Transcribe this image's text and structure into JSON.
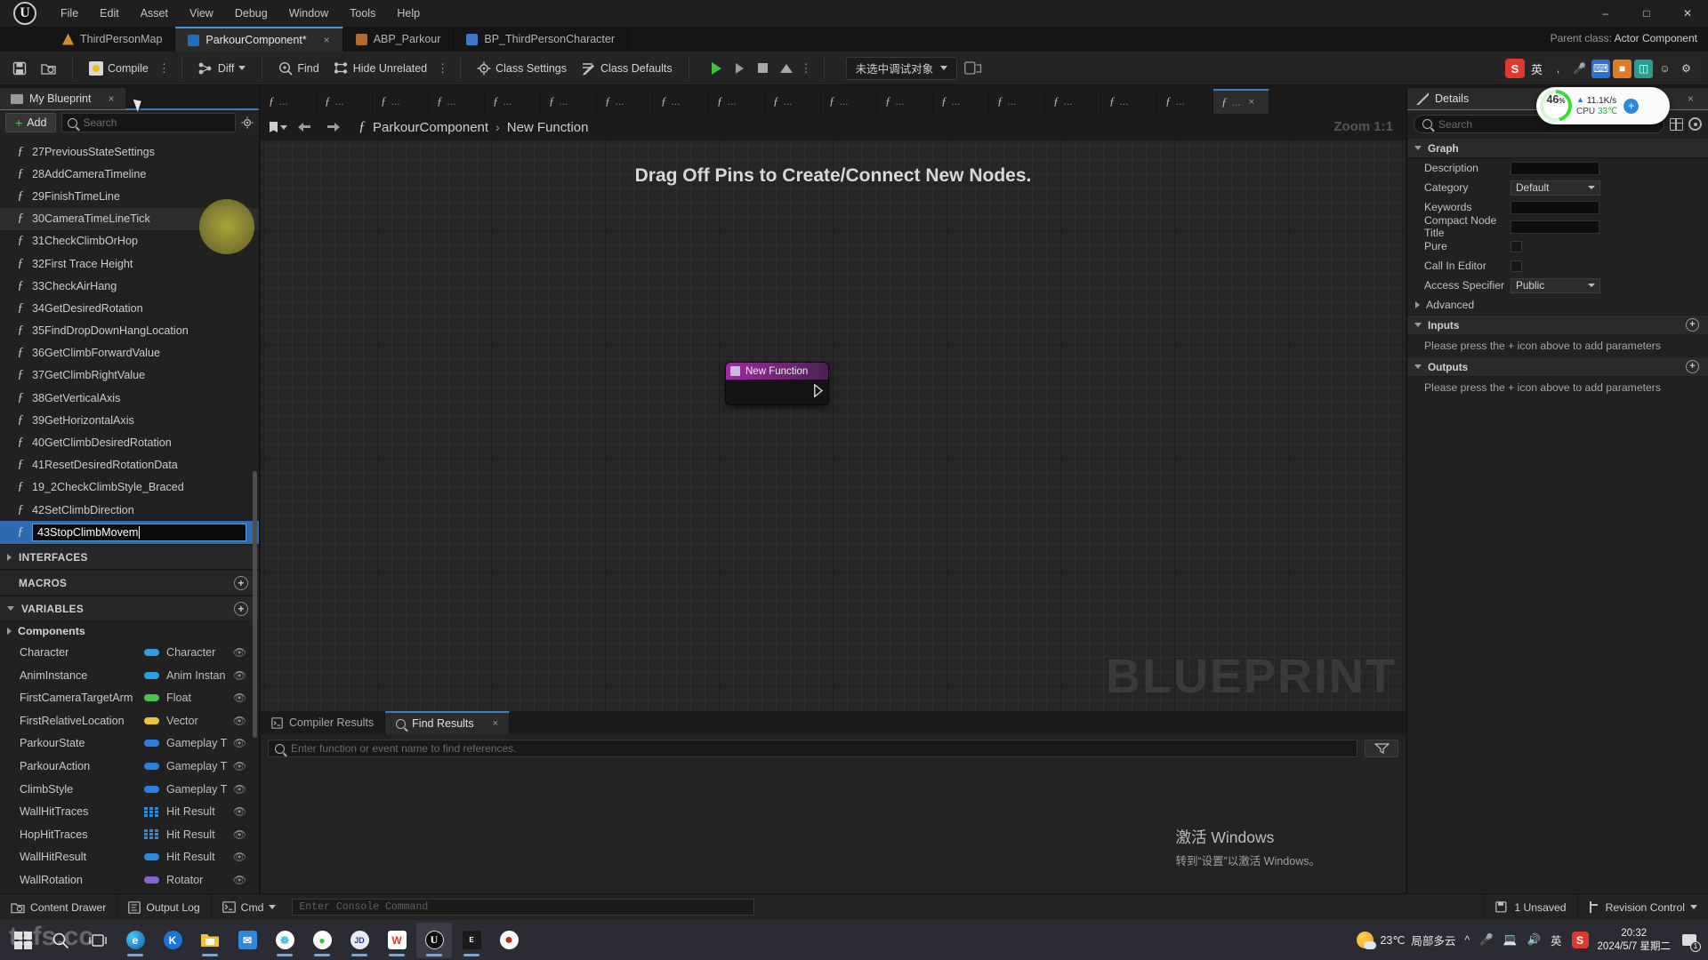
{
  "titlebar": {
    "logo": "ue-logo",
    "menus": [
      "File",
      "Edit",
      "Asset",
      "View",
      "Debug",
      "Window",
      "Tools",
      "Help"
    ],
    "window_controls": [
      "minimize",
      "maximize",
      "close"
    ]
  },
  "tabs": [
    {
      "label": "ThirdPersonMap",
      "icon": "map-icon",
      "active": false,
      "closable": false
    },
    {
      "label": "ParkourComponent*",
      "icon": "blueprint-icon",
      "active": true,
      "closable": true,
      "close_label": "×"
    },
    {
      "label": "ABP_Parkour",
      "icon": "anim-blueprint-icon",
      "active": false,
      "closable": false
    },
    {
      "label": "BP_ThirdPersonCharacter",
      "icon": "character-blueprint-icon",
      "active": false,
      "closable": false
    }
  ],
  "parent_class": {
    "prefix": "Parent class:",
    "value": "Actor Component"
  },
  "toolbar": {
    "save_label": "",
    "browse_label": "",
    "compile_label": "Compile",
    "diff_label": "Diff",
    "find_label": "Find",
    "hide_unrelated_label": "Hide Unrelated",
    "class_settings_label": "Class Settings",
    "class_defaults_label": "Class Defaults",
    "debug_object_label": "未选中调试对象",
    "overflow_dots": "⋮"
  },
  "ime": {
    "app_icon": "S",
    "lang": "英",
    "items": [
      "sogou-logo",
      "lang-en",
      "mic-icon",
      "keyboard-icon",
      "image-icon",
      "toolbox-icon",
      "emoji-icon",
      "settings-icon"
    ]
  },
  "my_blueprint": {
    "tab_label": "My Blueprint",
    "tab_close": "×",
    "add_label": "Add",
    "search_placeholder": "Search",
    "search_value": "",
    "functions": [
      {
        "name": "27PreviousStateSettings",
        "highlighted": false
      },
      {
        "name": "28AddCameraTimeline",
        "highlighted": false
      },
      {
        "name": "29FinishTimeLine",
        "highlighted": false
      },
      {
        "name": "30CameraTimeLineTick",
        "highlighted": true
      },
      {
        "name": "31CheckClimbOrHop",
        "highlighted": false
      },
      {
        "name": "32First Trace Height",
        "highlighted": false
      },
      {
        "name": "33CheckAirHang",
        "highlighted": false
      },
      {
        "name": "34GetDesiredRotation",
        "highlighted": false
      },
      {
        "name": "35FindDropDownHangLocation",
        "highlighted": false
      },
      {
        "name": "36GetClimbForwardValue",
        "highlighted": false
      },
      {
        "name": "37GetClimbRightValue",
        "highlighted": false
      },
      {
        "name": "38GetVerticalAxis",
        "highlighted": false
      },
      {
        "name": "39GetHorizontalAxis",
        "highlighted": false
      },
      {
        "name": "40GetClimbDesiredRotation",
        "highlighted": false
      },
      {
        "name": "41ResetDesiredRotationData",
        "highlighted": false
      },
      {
        "name": "19_2CheckClimbStyle_Braced",
        "highlighted": false
      },
      {
        "name": "42SetClimbDirection",
        "highlighted": false
      }
    ],
    "editing_function": {
      "value": "43StopClimbMovem"
    },
    "sections": {
      "interfaces": "INTERFACES",
      "macros": "MACROS",
      "variables": "VARIABLES"
    },
    "components_group": "Components",
    "variables": [
      {
        "name": "Character",
        "type": "Character",
        "color": "#2b9fe0",
        "shape": "pill"
      },
      {
        "name": "AnimInstance",
        "type": "Anim Instan",
        "color": "#2b9fe0",
        "shape": "pill"
      },
      {
        "name": "FirstCameraTargetArm",
        "type": "Float",
        "color": "#4bc44b",
        "shape": "pill"
      },
      {
        "name": "FirstRelativeLocation",
        "type": "Vector",
        "color": "#e8c33c",
        "shape": "pill"
      },
      {
        "name": "ParkourState",
        "type": "Gameplay T",
        "color": "#2b7fe0",
        "shape": "pill"
      },
      {
        "name": "ParkourAction",
        "type": "Gameplay T",
        "color": "#2b7fe0",
        "shape": "pill"
      },
      {
        "name": "ClimbStyle",
        "type": "Gameplay T",
        "color": "#2b7fe0",
        "shape": "pill"
      },
      {
        "name": "WallHitTraces",
        "type": "Hit Result",
        "color": "#2b8ae0",
        "shape": "grid"
      },
      {
        "name": "HopHitTraces",
        "type": "Hit Result",
        "color": "#2b8ae0",
        "shape": "grid"
      },
      {
        "name": "WallHitResult",
        "type": "Hit Result",
        "color": "#2b8ae0",
        "shape": "pill"
      },
      {
        "name": "WallRotation",
        "type": "Rotator",
        "color": "#8a63d2",
        "shape": "pill"
      }
    ]
  },
  "graph": {
    "tabs": [
      {
        "label": "...",
        "active": false
      },
      {
        "label": "...",
        "active": false
      },
      {
        "label": "...",
        "active": false
      },
      {
        "label": "...",
        "active": false
      },
      {
        "label": "...",
        "active": false
      },
      {
        "label": "...",
        "active": false
      },
      {
        "label": "...",
        "active": false
      },
      {
        "label": "...",
        "active": false
      },
      {
        "label": "...",
        "active": false
      },
      {
        "label": "...",
        "active": false
      },
      {
        "label": "...",
        "active": false
      },
      {
        "label": "...",
        "active": false
      },
      {
        "label": "...",
        "active": false
      },
      {
        "label": "...",
        "active": false
      },
      {
        "label": "...",
        "active": false
      },
      {
        "label": "...",
        "active": false
      },
      {
        "label": "...",
        "active": false
      },
      {
        "label": "...",
        "active": true,
        "close": "×"
      }
    ],
    "breadcrumb": {
      "root": "ParkourComponent",
      "separator": "›",
      "leaf": "New Function"
    },
    "zoom_label": "Zoom 1:1",
    "hint": "Drag Off Pins to Create/Connect New Nodes.",
    "watermark": "BLUEPRINT",
    "node": {
      "title": "New Function"
    }
  },
  "results": {
    "tabs": [
      {
        "label": "Compiler Results",
        "icon": "compiler-icon",
        "active": false
      },
      {
        "label": "Find Results",
        "icon": "search-icon",
        "active": true,
        "close": "×"
      }
    ],
    "search_placeholder": "Enter function or event name to find references.",
    "search_value": ""
  },
  "activate_windows": {
    "line1": "激活 Windows",
    "line2": "转到“设置”以激活 Windows。"
  },
  "details": {
    "tab_label": "Details",
    "tab_close": "×",
    "search_placeholder": "Search",
    "search_value": "",
    "graph_section": "Graph",
    "rows": [
      {
        "label": "Description",
        "kind": "text",
        "value": ""
      },
      {
        "label": "Category",
        "kind": "combo",
        "value": "Default"
      },
      {
        "label": "Keywords",
        "kind": "text",
        "value": ""
      },
      {
        "label": "Compact Node Title",
        "kind": "text",
        "value": ""
      },
      {
        "label": "Pure",
        "kind": "checkbox",
        "value": ""
      },
      {
        "label": "Call In Editor",
        "kind": "checkbox",
        "value": ""
      },
      {
        "label": "Access Specifier",
        "kind": "combo",
        "value": "Public"
      }
    ],
    "advanced_label": "Advanced",
    "inputs_label": "Inputs",
    "inputs_msg": "Please press the + icon above to add parameters",
    "outputs_label": "Outputs",
    "outputs_msg": "Please press the + icon above to add parameters",
    "add_symbol": "+"
  },
  "perf_badge": {
    "percent": "46",
    "percent_unit": "%",
    "net_rate": "11.1K/s",
    "cpu_label": "CPU",
    "cpu_temp": "33℃",
    "add_symbol": "+"
  },
  "statusbar": {
    "content_drawer": "Content Drawer",
    "output_log": "Output Log",
    "cmd_label": "Cmd",
    "console_placeholder": "Enter Console Command",
    "console_value": "",
    "unsaved": "1 Unsaved",
    "revision_control": "Revision Control"
  },
  "taskbar": {
    "apps": [
      {
        "name": "start-button",
        "glyph": "",
        "color": ""
      },
      {
        "name": "search-icon",
        "glyph": "",
        "color": ""
      },
      {
        "name": "task-view-icon",
        "glyph": "",
        "color": ""
      },
      {
        "name": "edge-icon",
        "glyph": "e",
        "color": "#2f9fd0"
      },
      {
        "name": "kugou-icon",
        "glyph": "K",
        "color": "#1b74d8"
      },
      {
        "name": "file-explorer-icon",
        "glyph": "",
        "color": "#f0c040"
      },
      {
        "name": "bird-app-icon",
        "glyph": "✉",
        "color": "#2b8ae0"
      },
      {
        "name": "cloud-disk-icon",
        "glyph": "☸",
        "color": "#3bb9e0"
      },
      {
        "name": "wechat-icon",
        "glyph": "●",
        "color": "#3fbf3f"
      },
      {
        "name": "jd-icon",
        "glyph": "JD",
        "color": "#e0e6f0"
      },
      {
        "name": "wps-icon",
        "glyph": "W",
        "color": "#e03a2f"
      },
      {
        "name": "unreal-engine-icon",
        "glyph": "U",
        "color": "#0e0e0e",
        "selected": true
      },
      {
        "name": "epic-games-icon",
        "glyph": "E",
        "color": "#1a1a1a"
      },
      {
        "name": "record-icon",
        "glyph": "●",
        "color": "#d02020"
      }
    ],
    "weather": {
      "temp": "23℃",
      "desc": "局部多云"
    },
    "tray": [
      "chevron-up-icon",
      "mic-icon",
      "display-icon",
      "volume-icon"
    ],
    "ime_lang": "英",
    "sogou": "S",
    "clock": {
      "time": "20:32",
      "date": "2024/5/7 星期二"
    },
    "notification_count": "1"
  },
  "watermark_overlay": "tafs.cc"
}
